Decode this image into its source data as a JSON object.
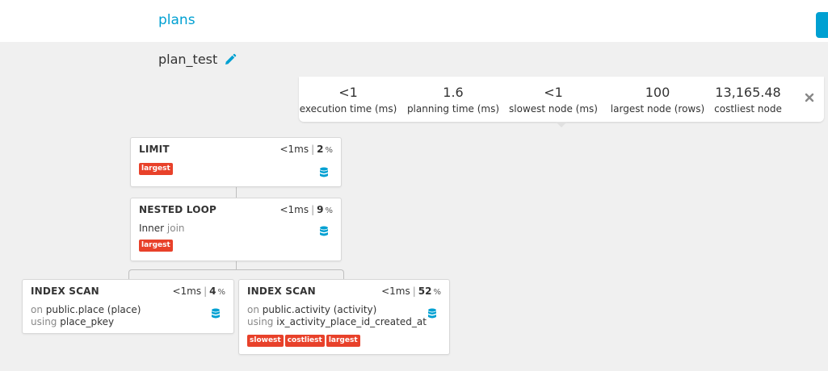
{
  "header": {
    "nav_link": "plans"
  },
  "plan": {
    "name": "plan_test"
  },
  "stats": [
    {
      "value": "<1",
      "label": "execution time (ms)"
    },
    {
      "value": "1.6",
      "label": "planning time (ms)"
    },
    {
      "value": "<1",
      "label": "slowest node (ms)"
    },
    {
      "value": "100",
      "label": "largest node (rows)"
    },
    {
      "value": "13,165.48",
      "label": "costliest node"
    }
  ],
  "nodes": [
    {
      "type": "LIMIT",
      "time": "<1ms",
      "sep": "|",
      "pct": "2",
      "pct_sign": "%",
      "tags": [
        "largest"
      ]
    },
    {
      "type": "NESTED LOOP",
      "time": "<1ms",
      "sep": "|",
      "pct": "9",
      "pct_sign": "%",
      "detail_value": "Inner",
      "detail_muted": "join",
      "tags": [
        "largest"
      ]
    },
    {
      "type": "INDEX SCAN",
      "time": "<1ms",
      "sep": "|",
      "pct": "4",
      "pct_sign": "%",
      "on_label": "on",
      "on_value": "public.place (place)",
      "using_label": "using",
      "using_value": "place_pkey",
      "tags": []
    },
    {
      "type": "INDEX SCAN",
      "time": "<1ms",
      "sep": "|",
      "pct": "52",
      "pct_sign": "%",
      "on_label": "on",
      "on_value": "public.activity (activity)",
      "using_label": "using",
      "using_value": "ix_activity_place_id_created_at",
      "tags": [
        "slowest",
        "costliest",
        "largest"
      ]
    }
  ],
  "icons": {
    "edit": "pencil-icon",
    "close": "close-icon",
    "node": "database-icon"
  },
  "colors": {
    "accent": "#00a0d2",
    "tag": "#e8412a"
  }
}
